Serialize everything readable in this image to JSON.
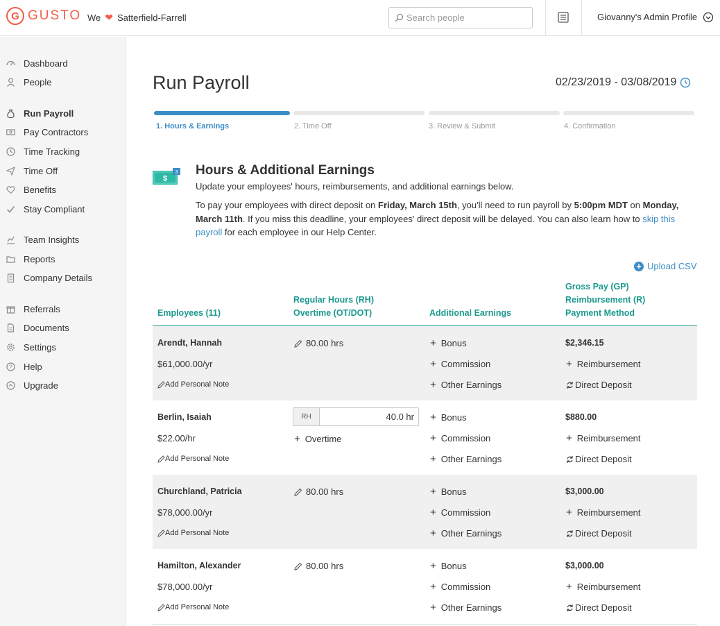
{
  "brand": {
    "logo_letter": "G",
    "name": "GUSTO",
    "accent": "#f45d48",
    "teal": "#1c9a8f",
    "blue": "#3c8dc5"
  },
  "header": {
    "we": "We",
    "company": "Satterfield-Farrell",
    "search_placeholder": "Search people",
    "profile": "Giovanny's Admin Profile"
  },
  "sidebar": {
    "items": [
      {
        "label": "Dashboard",
        "icon": "dashboard-icon"
      },
      {
        "label": "People",
        "icon": "person-icon"
      },
      {
        "label": "Run Payroll",
        "icon": "money-bag-icon",
        "active": true
      },
      {
        "label": "Pay Contractors",
        "icon": "cash-icon"
      },
      {
        "label": "Time Tracking",
        "icon": "clock-icon"
      },
      {
        "label": "Time Off",
        "icon": "plane-icon"
      },
      {
        "label": "Benefits",
        "icon": "heart-icon"
      },
      {
        "label": "Stay Compliant",
        "icon": "check-icon"
      },
      {
        "label": "Team Insights",
        "icon": "chart-icon"
      },
      {
        "label": "Reports",
        "icon": "folder-icon"
      },
      {
        "label": "Company Details",
        "icon": "building-icon"
      },
      {
        "label": "Referrals",
        "icon": "gift-icon"
      },
      {
        "label": "Documents",
        "icon": "document-icon"
      },
      {
        "label": "Settings",
        "icon": "gear-icon"
      },
      {
        "label": "Help",
        "icon": "help-icon"
      },
      {
        "label": "Upgrade",
        "icon": "upgrade-icon"
      }
    ]
  },
  "page": {
    "title": "Run Payroll",
    "date_range": "02/23/2019 - 03/08/2019"
  },
  "steps": [
    {
      "label": "1. Hours & Earnings",
      "active": true
    },
    {
      "label": "2. Time Off",
      "active": false
    },
    {
      "label": "3. Review & Submit",
      "active": false
    },
    {
      "label": "4. Confirmation",
      "active": false
    }
  ],
  "section": {
    "title": "Hours & Additional Earnings",
    "subtitle": "Update your employees' hours, reimbursements, and additional earnings below.",
    "p1": "To pay your employees with direct deposit on ",
    "b1": "Friday, March 15th",
    "p2": ", you'll need to run payroll by ",
    "b2": "5:00pm MDT",
    "p3": " on ",
    "b3": "Monday, March 11th",
    "p4": ". If you miss this deadline, your employees' direct deposit will be delayed. You can also learn how to ",
    "link": "skip this payroll",
    "p5": " for each employee in our Help Center."
  },
  "upload_csv": "Upload CSV",
  "table": {
    "headers": {
      "employees": "Employees (11)",
      "hours_1": "Regular Hours (RH)",
      "hours_2": "Overtime (OT/DOT)",
      "additional": "Additional Earnings",
      "gross_1": "Gross Pay (GP)",
      "gross_2": "Reimbursement (R)",
      "gross_3": "Payment Method"
    },
    "rows": [
      {
        "name": "Arendt, Hannah",
        "rate": "$61,000.00/yr",
        "note": "Add Personal Note",
        "hours": "80.00 hrs",
        "bonus": "Bonus",
        "commission": "Commission",
        "other": "Other Earnings",
        "gross": "$2,346.15",
        "reimb": "Reimbursement",
        "method": "Direct Deposit"
      },
      {
        "name": "Berlin, Isaiah",
        "rate": "$22.00/hr",
        "note": "Add Personal Note",
        "rh_tag": "RH",
        "rh_value": "40.0 hr",
        "overtime": "Overtime",
        "bonus": "Bonus",
        "commission": "Commission",
        "other": "Other Earnings",
        "gross": "$880.00",
        "reimb": "Reimbursement",
        "method": "Direct Deposit"
      },
      {
        "name": "Churchland, Patricia",
        "rate": "$78,000.00/yr",
        "note": "Add Personal Note",
        "hours": "80.00 hrs",
        "bonus": "Bonus",
        "commission": "Commission",
        "other": "Other Earnings",
        "gross": "$3,000.00",
        "reimb": "Reimbursement",
        "method": "Direct Deposit"
      },
      {
        "name": "Hamilton, Alexander",
        "rate": "$78,000.00/yr",
        "note": "Add Personal Note",
        "hours": "80.00 hrs",
        "bonus": "Bonus",
        "commission": "Commission",
        "other": "Other Earnings",
        "gross": "$3,000.00",
        "reimb": "Reimbursement",
        "method": "Direct Deposit"
      }
    ]
  }
}
